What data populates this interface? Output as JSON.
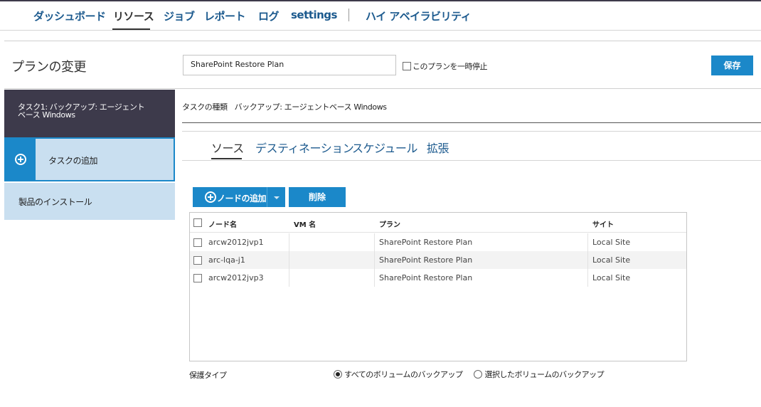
{
  "nav": {
    "items": [
      {
        "label": "ダッシュボード",
        "active": false
      },
      {
        "label": "リソース",
        "active": true
      },
      {
        "label": "ジョブ",
        "active": false
      },
      {
        "label": "レポート",
        "active": false
      },
      {
        "label": "ログ",
        "active": false
      },
      {
        "label": "settings",
        "active": false
      },
      {
        "label": "ハイ アベイラビリティ",
        "active": false
      }
    ]
  },
  "header": {
    "title": "プランの変更",
    "plan_name_value": "SharePoint Restore Plan",
    "pause_label": "このプランを一時停止",
    "pause_checked": false,
    "save_label": "保存"
  },
  "sidebar": {
    "task_line1": "タスク1: バックアップ: エージェント",
    "task_line2": "ベース Windows",
    "add_task_label": "タスクの追加",
    "install_label": "製品のインストール"
  },
  "task_type": {
    "label": "タスクの種類",
    "value": "バックアップ: エージェントベース Windows"
  },
  "tabs": [
    {
      "label": "ソース",
      "active": true
    },
    {
      "label": "デスティネーション",
      "active": false
    },
    {
      "label": "スケジュール",
      "active": false
    },
    {
      "label": "拡張",
      "active": false
    }
  ],
  "toolbar": {
    "add_node_label": "ノードの追加",
    "delete_label": "削除"
  },
  "grid": {
    "columns": [
      "ノード名",
      "VM 名",
      "プラン",
      "サイト"
    ],
    "rows": [
      {
        "node": "arcw2012jvp1",
        "vm": "",
        "plan": "SharePoint Restore Plan",
        "site": "Local Site"
      },
      {
        "node": "arc-lqa-j1",
        "vm": "",
        "plan": "SharePoint Restore Plan",
        "site": "Local Site"
      },
      {
        "node": "arcw2012jvp3",
        "vm": "",
        "plan": "SharePoint Restore Plan",
        "site": "Local Site"
      }
    ]
  },
  "protection": {
    "label": "保護タイプ",
    "options": [
      {
        "label": "すべてのボリュームのバックアップ",
        "selected": true
      },
      {
        "label": "選択したボリュームのバックアップ",
        "selected": false
      }
    ]
  },
  "colors": {
    "accent": "#1b88c9",
    "nav_link": "#1c5a8e",
    "sidebar_dark": "#3d3a4b",
    "sidebar_light": "#c9dff0"
  }
}
